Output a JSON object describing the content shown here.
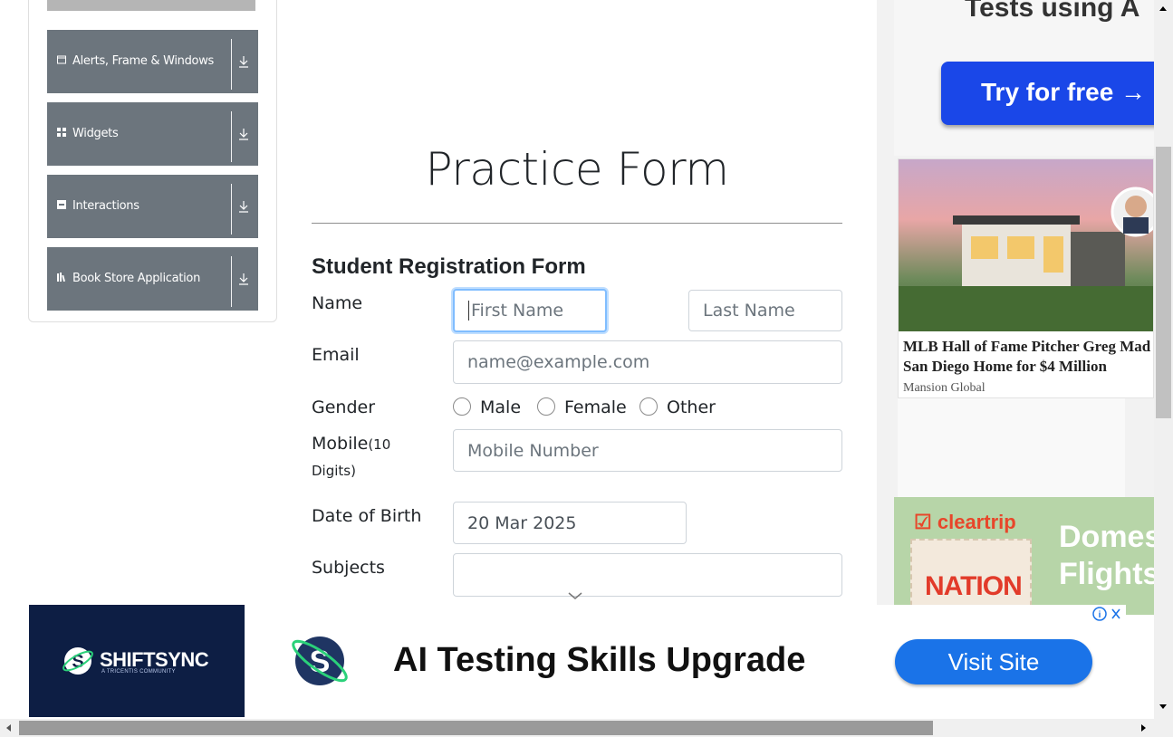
{
  "sidebar": {
    "groups": [
      {
        "label": "Alerts, Frame & Windows",
        "icon": "window-icon"
      },
      {
        "label": "Widgets",
        "icon": "widgets-icon"
      },
      {
        "label": "Interactions",
        "icon": "interactions-icon"
      },
      {
        "label": "Book Store Application",
        "icon": "book-icon"
      }
    ]
  },
  "main": {
    "title": "Practice Form",
    "subtitle": "Student Registration Form",
    "name_label": "Name",
    "first_name_placeholder": "First Name",
    "last_name_placeholder": "Last Name",
    "email_label": "Email",
    "email_placeholder": "name@example.com",
    "gender_label": "Gender",
    "gender_options": [
      "Male",
      "Female",
      "Other"
    ],
    "mobile_label": "Mobile",
    "mobile_hint_1": "(10",
    "mobile_hint_2": "Digits)",
    "mobile_placeholder": "Mobile Number",
    "dob_label": "Date of Birth",
    "dob_value": "20 Mar 2025",
    "subjects_label": "Subjects"
  },
  "ads": {
    "top_text": "Tests using A",
    "top_button": "Try for free →",
    "news_title": "MLB Hall of Fame Pitcher Greg Mad San Diego Home for $4 Million",
    "news_source": "Mansion Global",
    "cleartrip_logo": "cleartrip",
    "cleartrip_badge": "NATION",
    "cleartrip_headline_1": "Domes",
    "cleartrip_headline_2": "Flights",
    "banner_brand": "SHIFTSYNC",
    "banner_brand_sub": "A TRICENTIS COMMUNITY",
    "banner_text": "AI Testing Skills Upgrade",
    "banner_button": "Visit Site"
  },
  "colors": {
    "sidebar_group_bg": "#6c757d",
    "focus_border": "#80bdff",
    "visit_button": "#1a73e8",
    "try_button": "#1a47e8"
  }
}
